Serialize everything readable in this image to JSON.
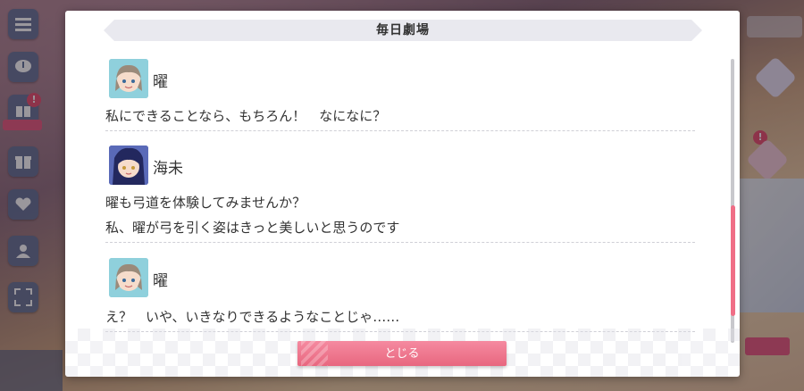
{
  "dialog": {
    "title": "毎日劇場",
    "close_label": "とじる",
    "entries": [
      {
        "speaker": "曜",
        "avatar": "you-avatar",
        "lines": [
          "私にできることなら、もちろん！　なになに？"
        ]
      },
      {
        "speaker": "海未",
        "avatar": "umi-avatar",
        "lines": [
          "曜も弓道を体験してみませんか？",
          "私、曜が弓を引く姿はきっと美しいと思うのです"
        ]
      },
      {
        "speaker": "曜",
        "avatar": "you-avatar",
        "lines": [
          "え？　いや、いきなりできるようなことじゃ……"
        ]
      }
    ],
    "scroll_position": 0.72
  },
  "sidebar": {
    "items": [
      "menu-icon",
      "chat-icon",
      "present-icon",
      "gift-icon",
      "heart-icon",
      "member-icon",
      "fullscreen-icon"
    ],
    "notification_glyph": "!"
  },
  "colors": {
    "accent": "#e8677f",
    "you_avatar_bg": "#8fd0dc",
    "umi_avatar_bg": "#3a4a9a"
  }
}
